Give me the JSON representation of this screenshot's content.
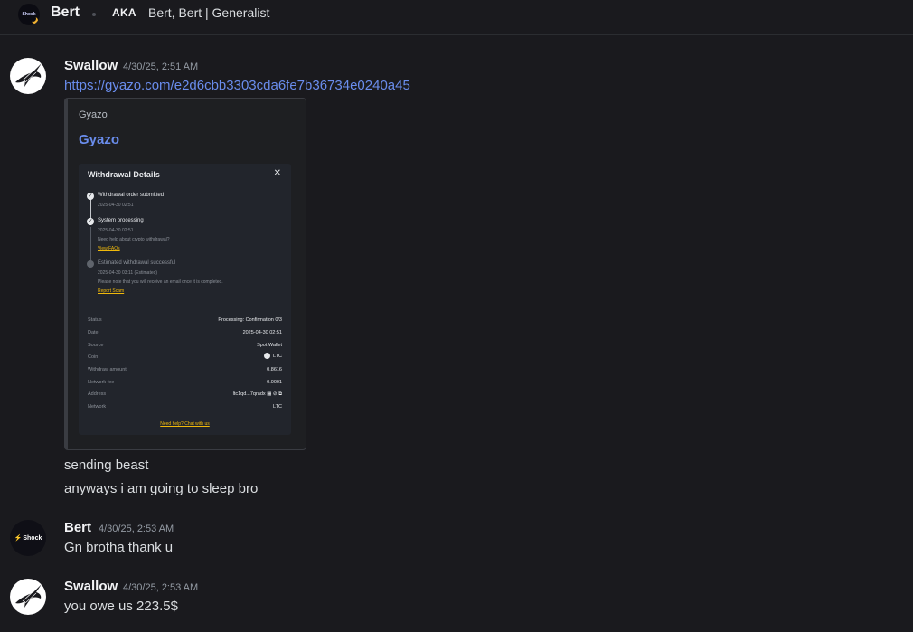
{
  "header": {
    "avatar_text": "Shock",
    "name": "Bert",
    "aka_label": "AKA",
    "aka_names": "Bert, Bert | Generalist"
  },
  "messages": [
    {
      "author": "Swallow",
      "timestamp": "4/30/25, 2:51 AM",
      "link": "https://gyazo.com/e2d6cbb3303cda6fe7b36734e0240a45",
      "embed": {
        "provider": "Gyazo",
        "title": "Gyazo",
        "screenshot": {
          "title": "Withdrawal Details",
          "close": "✕",
          "steps": [
            {
              "title": "Withdrawal order submitted",
              "time": "2025-04-30 02:51"
            },
            {
              "title": "System processing",
              "time": "2025-04-30 02:51",
              "note": "Need help about crypto withdrawal?",
              "link": "View FAQs"
            },
            {
              "title": "Estimated withdrawal successful",
              "time": "2025-04-30 03:11 (Estimated)",
              "note": "Please note that you will receive an email once it is completed.",
              "link": "Report Scam"
            }
          ],
          "details": [
            {
              "label": "Status",
              "value": "Processing: Confirmation 0/3"
            },
            {
              "label": "Date",
              "value": "2025-04-30 02:51"
            },
            {
              "label": "Source",
              "value": "Spot Wallet"
            },
            {
              "label": "Coin",
              "value": "LTC"
            },
            {
              "label": "Withdraw amount",
              "value": "0.8616"
            },
            {
              "label": "Network fee",
              "value": "0.0001"
            },
            {
              "label": "Address",
              "value": "ltc1qd...7qradx"
            },
            {
              "label": "Network",
              "value": "LTC"
            }
          ],
          "help_link": "Need help? Chat with us"
        }
      },
      "follow_ups": [
        "sending beast",
        "anyways i am going to sleep bro"
      ]
    },
    {
      "author": "Bert",
      "avatar_text": "Shock",
      "timestamp": "4/30/25, 2:53 AM",
      "text": "Gn brotha thank u"
    },
    {
      "author": "Swallow",
      "timestamp": "4/30/25, 2:53 AM",
      "text": "you owe us 223.5$"
    }
  ]
}
